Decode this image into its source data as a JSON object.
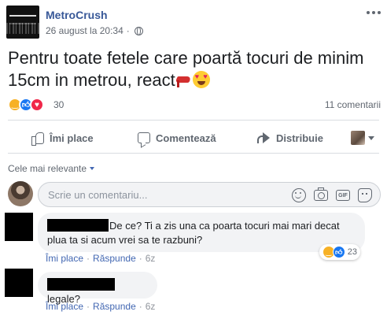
{
  "post": {
    "page_name": "MetroCrush",
    "timestamp": "26 august la 20:34",
    "audience_icon": "globe-icon",
    "text": "Pentru toate fetele care poartă tocuri de minim 15cm in metrou, react",
    "text_emojis": [
      "high-heel-emoji",
      "heart-eyes-emoji"
    ],
    "reaction_types": [
      "haha",
      "like",
      "love"
    ],
    "reaction_count": "30",
    "comment_count": "11 comentarii"
  },
  "actions": {
    "like_label": "Îmi place",
    "comment_label": "Comentează",
    "share_label": "Distribuie"
  },
  "comments_section": {
    "sort_label": "Cele mai relevante",
    "composer_placeholder": "Scrie un comentariu...",
    "composer_tools": [
      "smile-icon",
      "camera-icon",
      "gif-icon",
      "sticker-icon"
    ],
    "gif_text": "GIF"
  },
  "comments": [
    {
      "text_line1": "De ce? Ti a zis una ca poarta tocuri mai mari decat",
      "text_line2": "plua ta si acum vrei sa te razbuni?",
      "like_label": "Îmi place",
      "reply_label": "Răspunde",
      "age": "6z",
      "reaction_types": [
        "haha",
        "like"
      ],
      "reaction_count": "23"
    },
    {
      "text_line1": "legale?",
      "like_label": "Îmi place",
      "reply_label": "Răspunde",
      "age": "6z"
    }
  ],
  "colors": {
    "link": "#385898",
    "action_link": "#4267b2",
    "muted": "#606770",
    "bubble_bg": "#f2f3f5",
    "like_blue": "#1877f2",
    "love_red": "#f0284a",
    "haha_yellow": "#f7b125"
  }
}
